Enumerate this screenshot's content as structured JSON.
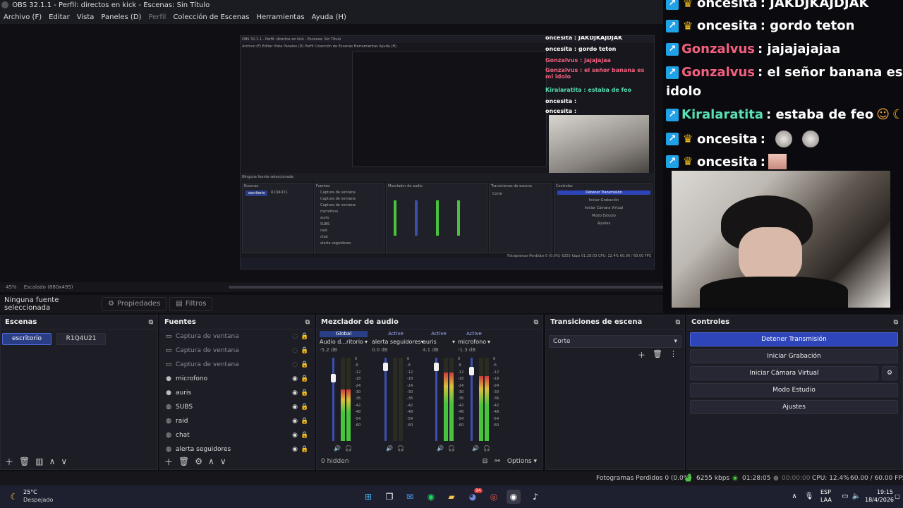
{
  "window": {
    "title": "OBS 32.1.1 - Perfil: directos en kick - Escenas: Sin Título"
  },
  "menu": [
    "Archivo (F)",
    "Editar",
    "Vista",
    "Paneles (D)",
    "Perfil",
    "Colección de Escenas",
    "Herramientas",
    "Ayuda (H)"
  ],
  "preview": {
    "zoom": "45%",
    "scale": "Escalado (880x495)",
    "nested_title": "OBS 32.1.1 - Perfil: directos en kick - Escenas: Sin Título",
    "nested_menu": "Archivo (F)   Editar   Vista   Paneles (D)   Perfil   Colección de Escenas   Herramientas   Ayuda (H)",
    "nested_chat": [
      "oncesita : JAKDJKAJDJAK",
      "oncesita : gordo teton",
      "Gonzalvus : jajajajaa",
      "Gonzalvus : el señor banana es mi idolo",
      "Kiralaratita : estaba de feo",
      "oncesita :",
      "oncesita :"
    ],
    "nested_sourcebar": "Ninguna fuente seleccionada",
    "nested_docks": [
      "Escenas",
      "Fuentes",
      "Mezclador de audio",
      "Transiciones de escena",
      "Controles"
    ],
    "nested_scenes": [
      "escritorio",
      "R1Q4U21"
    ],
    "nested_sources": [
      "Captura de ventana",
      "Captura de ventana",
      "Captura de ventana",
      "microfono",
      "auris",
      "SUBS",
      "raid",
      "chat",
      "alerta seguidores"
    ],
    "nested_controls": [
      "Detener Transmisión",
      "Iniciar Grabación",
      "Iniciar Cámara Virtual",
      "Modo Estudio",
      "Ajustes"
    ],
    "nested_transition": "Corte",
    "nested_status": "Fotogramas Perdidos 0 (0.0%)   6255 kbps   01:28:03   CPU: 12.4%   60.00 / 60.00 FPS"
  },
  "chat": [
    {
      "user": "oncesita",
      "color": "#f3f3f3",
      "text": ": JAKDJKAJDJAK",
      "badges": [
        "kick",
        "crown"
      ]
    },
    {
      "user": "oncesita",
      "color": "#f3f3f3",
      "text": ": gordo teton",
      "badges": [
        "kick",
        "crown"
      ]
    },
    {
      "user": "Gonzalvus",
      "color": "#f2607f",
      "text": ": jajajajajaa",
      "badges": [
        "kick"
      ]
    },
    {
      "user": "Gonzalvus",
      "color": "#f2607f",
      "text": ": el señor banana es mi",
      "text2": "idolo",
      "badges": [
        "kick"
      ]
    },
    {
      "user": "Kiralaratita",
      "color": "#58e0b3",
      "text": ": estaba de feo",
      "badges": [
        "kick"
      ]
    },
    {
      "user": "oncesita",
      "color": "#f3f3f3",
      "text": ":",
      "badges": [
        "kick",
        "crown"
      ]
    },
    {
      "user": "oncesita",
      "color": "#f3f3f3",
      "text": ":",
      "badges": [
        "kick",
        "crown"
      ]
    }
  ],
  "sourcebar": {
    "no_source": "Ninguna fuente seleccionada",
    "properties": "Propiedades",
    "filters": "Filtros"
  },
  "scenes": {
    "title": "Escenas",
    "items": [
      "escritorio",
      "R1Q4U21"
    ],
    "active": "escritorio"
  },
  "sources": {
    "title": "Fuentes",
    "items": [
      {
        "label": "Captura de ventana",
        "icon": "window-icon",
        "visible": false
      },
      {
        "label": "Captura de ventana",
        "icon": "window-icon",
        "visible": false
      },
      {
        "label": "Captura de ventana",
        "icon": "window-icon",
        "visible": false
      },
      {
        "label": "microfono",
        "icon": "mic-icon",
        "visible": true
      },
      {
        "label": "auris",
        "icon": "mic-icon",
        "visible": true
      },
      {
        "label": "SUBS",
        "icon": "browser-icon",
        "visible": true
      },
      {
        "label": "raid",
        "icon": "browser-icon",
        "visible": true
      },
      {
        "label": "chat",
        "icon": "browser-icon",
        "visible": true
      },
      {
        "label": "alerta seguidores",
        "icon": "browser-icon",
        "visible": true
      }
    ]
  },
  "mixer": {
    "title": "Mezclador de audio",
    "channels": [
      {
        "tab": "Global",
        "name": "Audio d...ritorio",
        "db": "-5.2 dB",
        "level": 0.62,
        "fader": 0.78
      },
      {
        "tab": "Active",
        "name": "alerta seguidores",
        "db": "0.0 dB",
        "level": 0.0,
        "fader": 0.93
      },
      {
        "tab": "Active",
        "name": "auris",
        "db": "4.1 dB",
        "level": 0.82,
        "fader": 0.93
      },
      {
        "tab": "Active",
        "name": "microfono",
        "db": "-1.3 dB",
        "level": 0.78,
        "fader": 0.88
      }
    ],
    "scale": [
      "0",
      "-6",
      "-12",
      "-18",
      "-24",
      "-30",
      "-36",
      "-42",
      "-48",
      "-54",
      "-60"
    ],
    "hidden": "0 hidden",
    "options": "Options"
  },
  "transitions": {
    "title": "Transiciones de escena",
    "selected": "Corte"
  },
  "controls": {
    "title": "Controles",
    "buttons": [
      "Detener Transmisión",
      "Iniciar Grabación",
      "Iniciar Cámara Virtual",
      "Modo Estudio",
      "Ajustes"
    ]
  },
  "status": {
    "dropped": "Fotogramas Perdidos 0 (0.0%)",
    "bitrate": "6255 kbps",
    "stream_time": "01:28:05",
    "rec_time": "00:00:00",
    "cpu": "CPU: 12.4%",
    "fps": "60.00 / 60.00 FPS"
  },
  "taskbar": {
    "weather_temp": "25°C",
    "weather_desc": "Despejado",
    "lang1": "ESP",
    "lang2": "LAA",
    "time": "19:15",
    "date": "18/4/2026",
    "notif_badge": "94"
  },
  "colors": {
    "accent": "#2d45b8",
    "kick": "#1fa2e6",
    "crown": "#f6c21a"
  }
}
